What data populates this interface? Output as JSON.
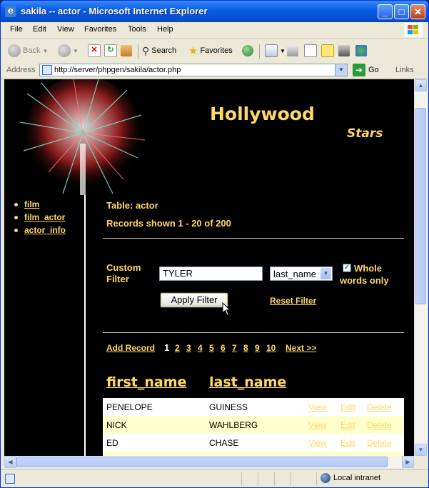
{
  "window": {
    "title": "sakila -- actor - Microsoft Internet Explorer",
    "minimize": "_",
    "maximize": "□",
    "close": "✕"
  },
  "menu": [
    "File",
    "Edit",
    "View",
    "Favorites",
    "Tools",
    "Help"
  ],
  "toolbar": {
    "back": "Back",
    "search": "Search",
    "favorites": "Favorites"
  },
  "address": {
    "label": "Address",
    "url": "http://server/phpgen/sakila/actor.php",
    "go": "Go",
    "links": "Links"
  },
  "page": {
    "heading": "Hollywood",
    "subheading": "Stars",
    "nav": [
      "film",
      "film_actor",
      "actor_info"
    ],
    "table_label": "Table: actor",
    "records": "Records shown 1 - 20 of 200",
    "filter": {
      "label_line1": "Custom",
      "label_line2": "Filter",
      "value": "TYLER",
      "field": "last_name",
      "whole_words_line1": "Whole",
      "whole_words_line2": "words only",
      "whole_words_checked": true,
      "apply": "Apply Filter",
      "reset": "Reset Filter"
    },
    "add_record": "Add Record",
    "pages": [
      "1",
      "2",
      "3",
      "4",
      "5",
      "6",
      "7",
      "8",
      "9",
      "10"
    ],
    "current_page": "1",
    "next": "Next >>",
    "columns": [
      "first_name",
      "last_name"
    ],
    "actions": [
      "View",
      "Edit",
      "Delete"
    ],
    "rows": [
      {
        "first_name": "PENELOPE",
        "last_name": "GUINESS",
        "bg": "#ffffff"
      },
      {
        "first_name": "NICK",
        "last_name": "WAHLBERG",
        "bg": "#ffffcc"
      },
      {
        "first_name": "ED",
        "last_name": "CHASE",
        "bg": "#ffffff"
      }
    ],
    "accent": "#ffd966"
  },
  "status": {
    "zone": "Local intranet"
  }
}
